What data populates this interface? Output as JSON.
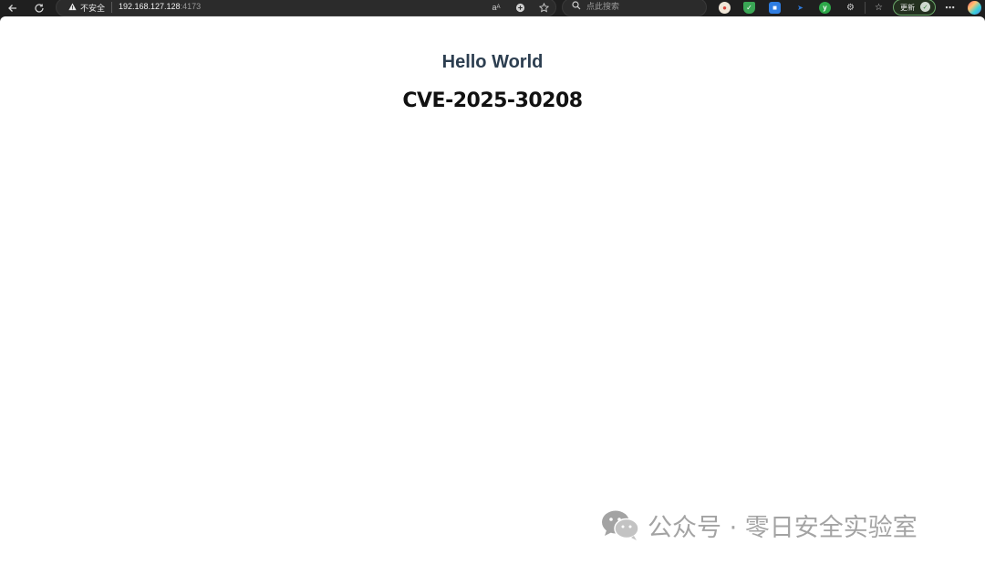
{
  "toolbar": {
    "back_icon": "arrow-left-icon",
    "refresh_icon": "refresh-icon",
    "address": {
      "security_icon": "warning-triangle-icon",
      "security_label": "不安全",
      "host": "192.168.127.128",
      "port": ":4173",
      "read_aloud_icon": "read-aloud-icon",
      "translate_icon": "translate-icon",
      "favorite_icon": "star-icon"
    },
    "search": {
      "placeholder": "点此搜索"
    },
    "extensions": [
      {
        "name": "extension-red-icon",
        "color": "#d9453a",
        "glyph": "●"
      },
      {
        "name": "extension-shield-icon",
        "color": "#3aa655",
        "glyph": "✓"
      },
      {
        "name": "extension-blue-icon",
        "color": "#2f7de1",
        "glyph": "■"
      },
      {
        "name": "extension-arrow-icon",
        "color": "#1f5fbf",
        "glyph": "➤"
      },
      {
        "name": "extension-green-icon",
        "color": "#2ea84a",
        "glyph": "y"
      }
    ],
    "update_label": "更新",
    "colors": {
      "chrome_bg": "#1f1f1f",
      "accent_update": "#6aa86a"
    }
  },
  "page": {
    "heading": "Hello World",
    "subheading": "CVE-2025-30208",
    "heading_color": "#2c3e50"
  },
  "watermark": {
    "text": "公众号 · 零日安全实验室",
    "logo_icon": "wechat-logo-icon"
  }
}
